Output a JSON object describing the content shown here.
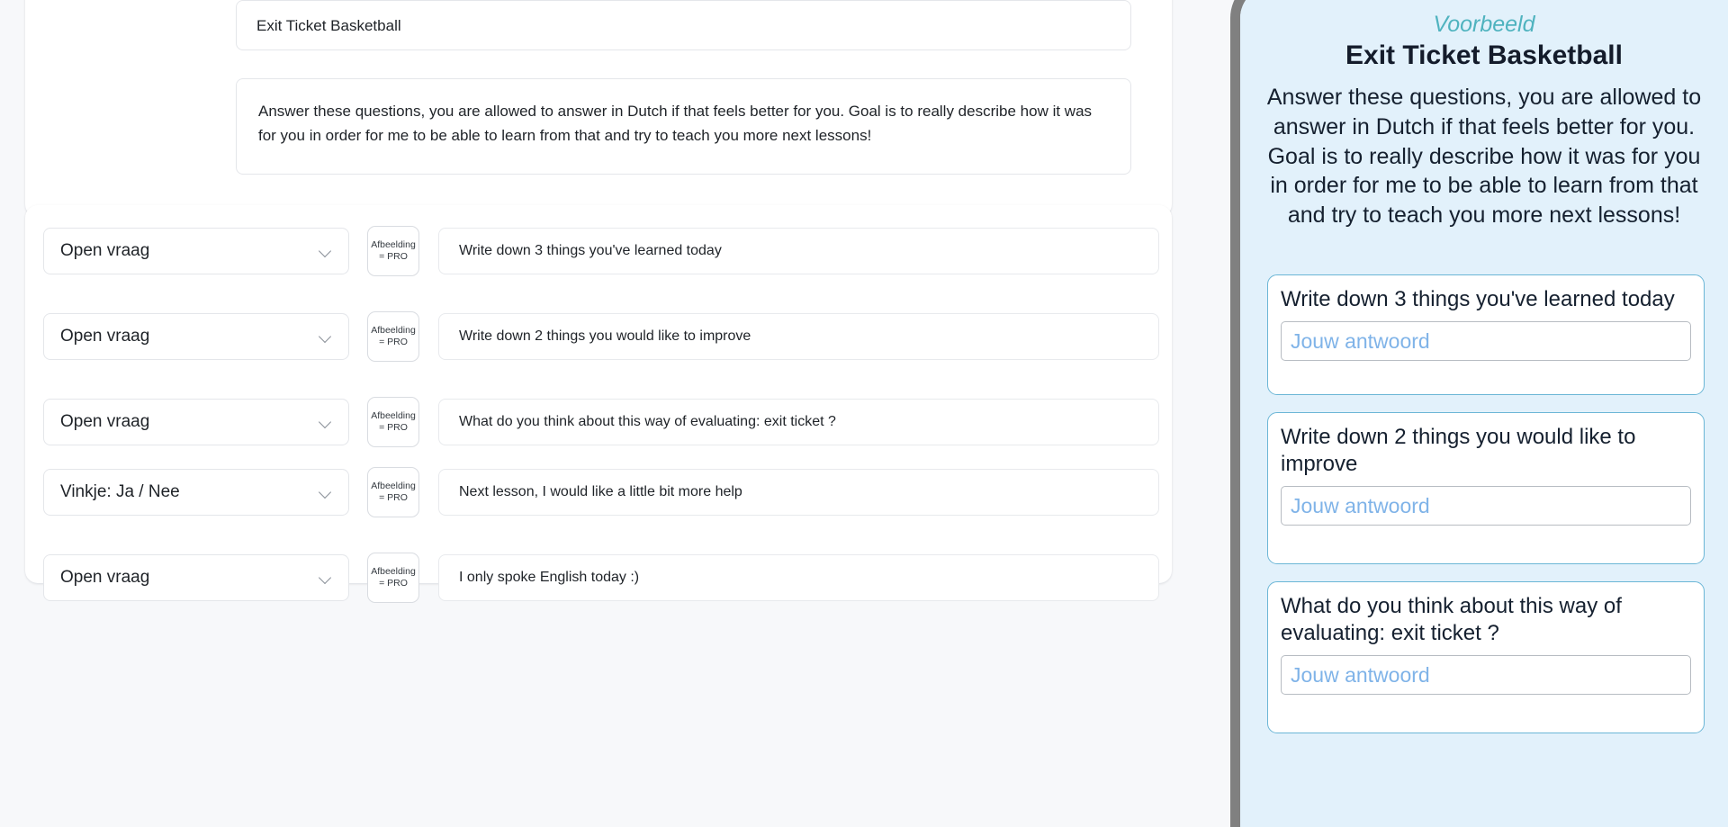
{
  "editor": {
    "form_title": "Exit Ticket Basketball",
    "form_description": "Answer these questions, you are allowed to answer in Dutch if that feels better for you. Goal is to really describe how it was for you in order for me to be able to learn from that and try to teach you more next lessons!",
    "pro_button": {
      "line1": "Afbeelding",
      "line2": "= PRO"
    },
    "questions": [
      {
        "type": "Open vraag",
        "text": "Write down 3 things you've learned today"
      },
      {
        "type": "Open vraag",
        "text": "Write down 2 things you would like to improve"
      },
      {
        "type": "Open vraag",
        "text": "What do you think about this way of evaluating: exit ticket ?"
      },
      {
        "type": "Vinkje: Ja / Nee",
        "text": "Next lesson, I would like a little bit more help"
      },
      {
        "type": "Open vraag",
        "text": "I only spoke English today :)"
      }
    ]
  },
  "preview": {
    "label": "Voorbeeld",
    "title": "Exit Ticket Basketball",
    "description": "Answer these questions, you are allowed to answer in Dutch if that feels better for you. Goal is to really describe how it was for you in order for me to be able to learn from that and try to teach you more next lessons!",
    "answer_placeholder": "Jouw antwoord",
    "questions": [
      {
        "text": "Write down 3 things you've learned today",
        "placeholder": "Jouw antwoord"
      },
      {
        "text": "Write down 2 things you would like to improve",
        "placeholder": "Jouw antwoord"
      },
      {
        "text": "What do you think about this way of evaluating: exit ticket ?",
        "placeholder": "Jouw antwoord"
      }
    ]
  },
  "colors": {
    "page_background": "#f7f8fa",
    "card_background": "#ffffff",
    "preview_background": "#e2f1fb",
    "phone_frame": "#808080",
    "accent_teal": "#4fb3bf",
    "preview_card_border": "#6bb6d6",
    "placeholder_blue": "#7fb3e8",
    "text_dark": "#15202f"
  }
}
